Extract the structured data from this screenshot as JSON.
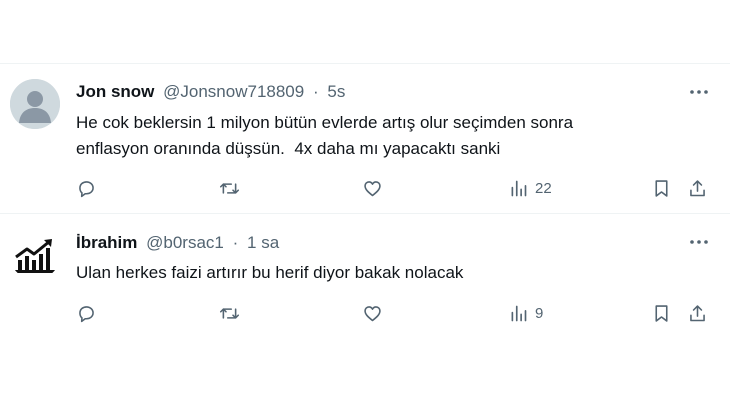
{
  "tweets": [
    {
      "display_name": "Jon snow",
      "handle": "@Jonsnow718809",
      "separator": "·",
      "time": "5s",
      "text_lines": [
        "He cok beklersin 1 milyon bütün evlerde artış olur seçimden sonra",
        "enflasyon oranında düşsün.  4x daha mı yapacaktı sanki"
      ],
      "views": "22",
      "avatar_icon": "default-user-icon"
    },
    {
      "display_name": "İbrahim",
      "handle": "@b0rsac1",
      "separator": "·",
      "time": "1 sa",
      "text_lines": [
        "Ulan herkes faizi artırır bu herif diyor bakak nolacak"
      ],
      "views": "9",
      "avatar_icon": "rising-chart-icon"
    }
  ],
  "colors": {
    "text_primary": "#0f1419",
    "text_secondary": "#536471",
    "divider": "#eff3f4",
    "default_avatar_bg": "#cfd9de"
  },
  "icons": [
    "reply-icon",
    "retweet-icon",
    "like-icon",
    "views-icon",
    "bookmark-icon",
    "share-icon",
    "more-icon"
  ]
}
